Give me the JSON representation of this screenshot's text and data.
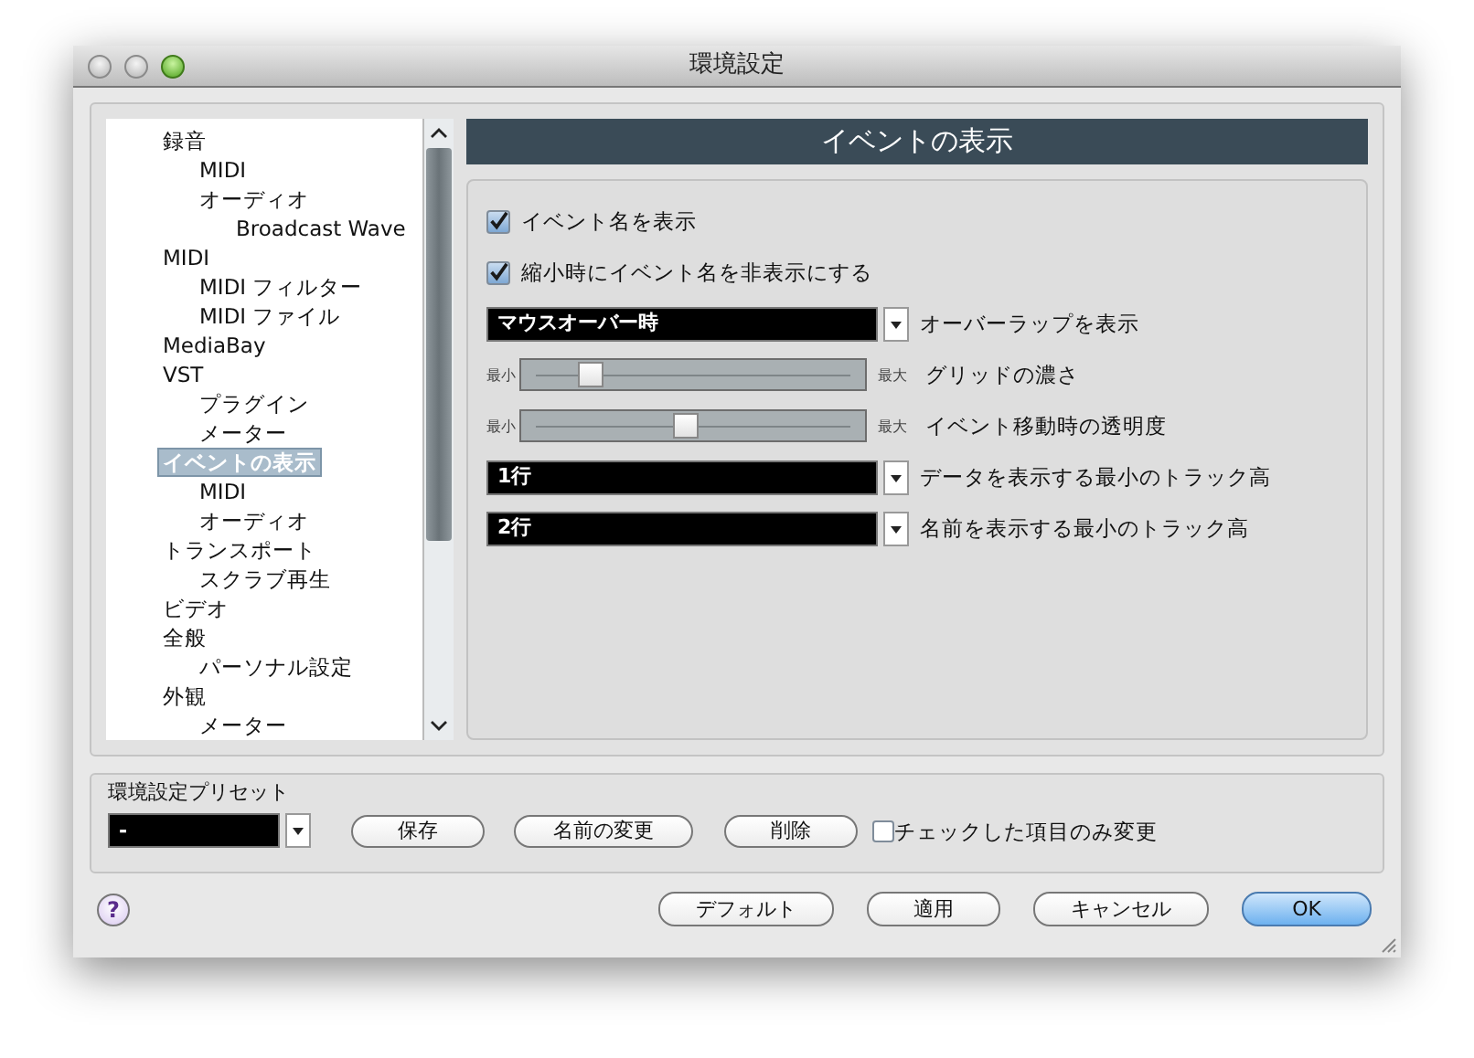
{
  "window": {
    "title": "環境設定"
  },
  "tree": [
    {
      "label": "録音",
      "selected": false,
      "children": [
        {
          "label": "MIDI",
          "selected": false
        },
        {
          "label": "オーディオ",
          "selected": false,
          "children": [
            {
              "label": "Broadcast Wave",
              "selected": false
            }
          ]
        }
      ]
    },
    {
      "label": "MIDI",
      "selected": false,
      "children": [
        {
          "label": "MIDI フィルター",
          "selected": false
        },
        {
          "label": "MIDI ファイル",
          "selected": false
        }
      ]
    },
    {
      "label": "MediaBay",
      "selected": false
    },
    {
      "label": "VST",
      "selected": false,
      "children": [
        {
          "label": "プラグイン",
          "selected": false
        },
        {
          "label": "メーター",
          "selected": false
        }
      ]
    },
    {
      "label": "イベントの表示",
      "selected": true,
      "children": [
        {
          "label": "MIDI",
          "selected": false
        },
        {
          "label": "オーディオ",
          "selected": false
        }
      ]
    },
    {
      "label": "トランスポート",
      "selected": false,
      "children": [
        {
          "label": "スクラブ再生",
          "selected": false
        }
      ]
    },
    {
      "label": "ビデオ",
      "selected": false
    },
    {
      "label": "全般",
      "selected": false,
      "children": [
        {
          "label": "パーソナル設定",
          "selected": false
        }
      ]
    },
    {
      "label": "外観",
      "selected": false,
      "children": [
        {
          "label": "メーター",
          "selected": false
        }
      ]
    }
  ],
  "page_title": "イベントの表示",
  "settings": [
    {
      "kind": "checkbox",
      "label": "イベント名を表示",
      "checked": true
    },
    {
      "kind": "checkbox",
      "label": "縮小時にイベント名を非表示にする",
      "checked": true
    },
    {
      "kind": "dropdown",
      "selection": "マウスオーバー時",
      "label": "オーバーラップを表示"
    },
    {
      "kind": "slider",
      "min_label": "最小",
      "max_label": "最大",
      "label": "グリッドの濃さ",
      "level": 0.18
    },
    {
      "kind": "slider",
      "min_label": "最小",
      "max_label": "最大",
      "label": "イベント移動時の透明度",
      "level": 0.5
    },
    {
      "kind": "dropdown",
      "selection": "1行",
      "label": "データを表示する最小のトラック高"
    },
    {
      "kind": "dropdown",
      "selection": "2行",
      "label": "名前を表示する最小のトラック高"
    }
  ],
  "presets": {
    "title": "環境設定プリセット",
    "value": "-",
    "buttons": [
      "保存",
      "名前の変更",
      "削除"
    ],
    "checkbox": {
      "label": "チェックした項目のみ変更",
      "checked": false
    }
  },
  "help": "?",
  "buttons": [
    {
      "label": "デフォルト",
      "default": false
    },
    {
      "label": "適用",
      "default": false
    },
    {
      "label": "キャンセル",
      "default": false
    },
    {
      "label": "OK",
      "default": true
    }
  ]
}
